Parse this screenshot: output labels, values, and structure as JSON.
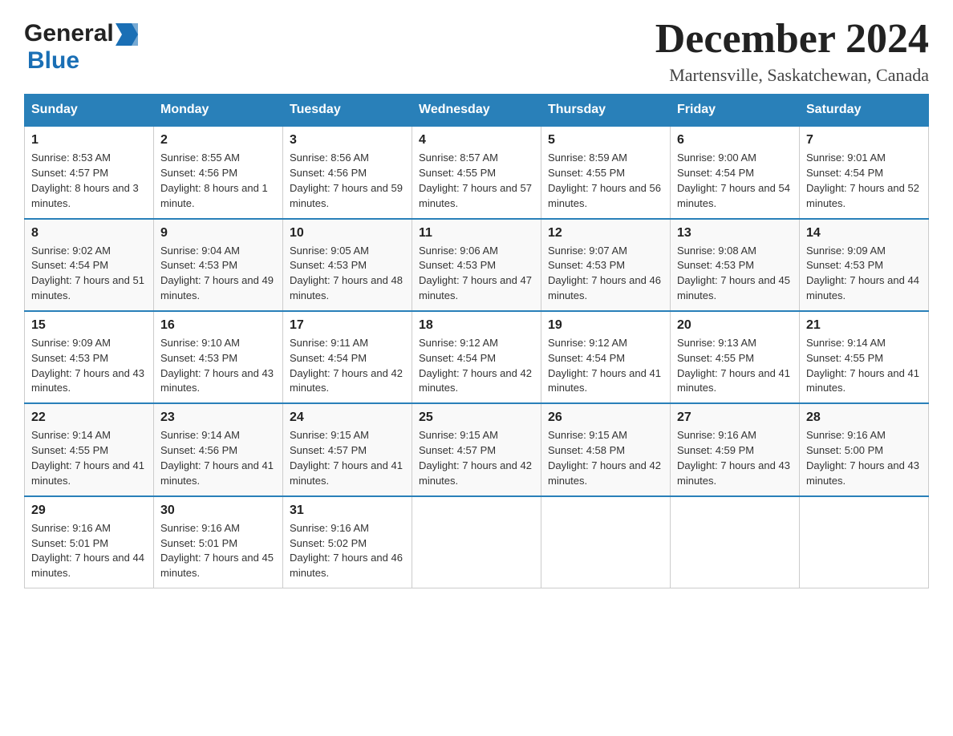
{
  "header": {
    "logo_general": "General",
    "logo_blue": "Blue",
    "month_title": "December 2024",
    "location": "Martensville, Saskatchewan, Canada"
  },
  "calendar": {
    "days_of_week": [
      "Sunday",
      "Monday",
      "Tuesday",
      "Wednesday",
      "Thursday",
      "Friday",
      "Saturday"
    ],
    "weeks": [
      [
        {
          "day": "1",
          "sunrise": "8:53 AM",
          "sunset": "4:57 PM",
          "daylight": "8 hours and 3 minutes."
        },
        {
          "day": "2",
          "sunrise": "8:55 AM",
          "sunset": "4:56 PM",
          "daylight": "8 hours and 1 minute."
        },
        {
          "day": "3",
          "sunrise": "8:56 AM",
          "sunset": "4:56 PM",
          "daylight": "7 hours and 59 minutes."
        },
        {
          "day": "4",
          "sunrise": "8:57 AM",
          "sunset": "4:55 PM",
          "daylight": "7 hours and 57 minutes."
        },
        {
          "day": "5",
          "sunrise": "8:59 AM",
          "sunset": "4:55 PM",
          "daylight": "7 hours and 56 minutes."
        },
        {
          "day": "6",
          "sunrise": "9:00 AM",
          "sunset": "4:54 PM",
          "daylight": "7 hours and 54 minutes."
        },
        {
          "day": "7",
          "sunrise": "9:01 AM",
          "sunset": "4:54 PM",
          "daylight": "7 hours and 52 minutes."
        }
      ],
      [
        {
          "day": "8",
          "sunrise": "9:02 AM",
          "sunset": "4:54 PM",
          "daylight": "7 hours and 51 minutes."
        },
        {
          "day": "9",
          "sunrise": "9:04 AM",
          "sunset": "4:53 PM",
          "daylight": "7 hours and 49 minutes."
        },
        {
          "day": "10",
          "sunrise": "9:05 AM",
          "sunset": "4:53 PM",
          "daylight": "7 hours and 48 minutes."
        },
        {
          "day": "11",
          "sunrise": "9:06 AM",
          "sunset": "4:53 PM",
          "daylight": "7 hours and 47 minutes."
        },
        {
          "day": "12",
          "sunrise": "9:07 AM",
          "sunset": "4:53 PM",
          "daylight": "7 hours and 46 minutes."
        },
        {
          "day": "13",
          "sunrise": "9:08 AM",
          "sunset": "4:53 PM",
          "daylight": "7 hours and 45 minutes."
        },
        {
          "day": "14",
          "sunrise": "9:09 AM",
          "sunset": "4:53 PM",
          "daylight": "7 hours and 44 minutes."
        }
      ],
      [
        {
          "day": "15",
          "sunrise": "9:09 AM",
          "sunset": "4:53 PM",
          "daylight": "7 hours and 43 minutes."
        },
        {
          "day": "16",
          "sunrise": "9:10 AM",
          "sunset": "4:53 PM",
          "daylight": "7 hours and 43 minutes."
        },
        {
          "day": "17",
          "sunrise": "9:11 AM",
          "sunset": "4:54 PM",
          "daylight": "7 hours and 42 minutes."
        },
        {
          "day": "18",
          "sunrise": "9:12 AM",
          "sunset": "4:54 PM",
          "daylight": "7 hours and 42 minutes."
        },
        {
          "day": "19",
          "sunrise": "9:12 AM",
          "sunset": "4:54 PM",
          "daylight": "7 hours and 41 minutes."
        },
        {
          "day": "20",
          "sunrise": "9:13 AM",
          "sunset": "4:55 PM",
          "daylight": "7 hours and 41 minutes."
        },
        {
          "day": "21",
          "sunrise": "9:14 AM",
          "sunset": "4:55 PM",
          "daylight": "7 hours and 41 minutes."
        }
      ],
      [
        {
          "day": "22",
          "sunrise": "9:14 AM",
          "sunset": "4:55 PM",
          "daylight": "7 hours and 41 minutes."
        },
        {
          "day": "23",
          "sunrise": "9:14 AM",
          "sunset": "4:56 PM",
          "daylight": "7 hours and 41 minutes."
        },
        {
          "day": "24",
          "sunrise": "9:15 AM",
          "sunset": "4:57 PM",
          "daylight": "7 hours and 41 minutes."
        },
        {
          "day": "25",
          "sunrise": "9:15 AM",
          "sunset": "4:57 PM",
          "daylight": "7 hours and 42 minutes."
        },
        {
          "day": "26",
          "sunrise": "9:15 AM",
          "sunset": "4:58 PM",
          "daylight": "7 hours and 42 minutes."
        },
        {
          "day": "27",
          "sunrise": "9:16 AM",
          "sunset": "4:59 PM",
          "daylight": "7 hours and 43 minutes."
        },
        {
          "day": "28",
          "sunrise": "9:16 AM",
          "sunset": "5:00 PM",
          "daylight": "7 hours and 43 minutes."
        }
      ],
      [
        {
          "day": "29",
          "sunrise": "9:16 AM",
          "sunset": "5:01 PM",
          "daylight": "7 hours and 44 minutes."
        },
        {
          "day": "30",
          "sunrise": "9:16 AM",
          "sunset": "5:01 PM",
          "daylight": "7 hours and 45 minutes."
        },
        {
          "day": "31",
          "sunrise": "9:16 AM",
          "sunset": "5:02 PM",
          "daylight": "7 hours and 46 minutes."
        },
        null,
        null,
        null,
        null
      ]
    ],
    "labels": {
      "sunrise": "Sunrise: ",
      "sunset": "Sunset: ",
      "daylight": "Daylight: "
    }
  }
}
